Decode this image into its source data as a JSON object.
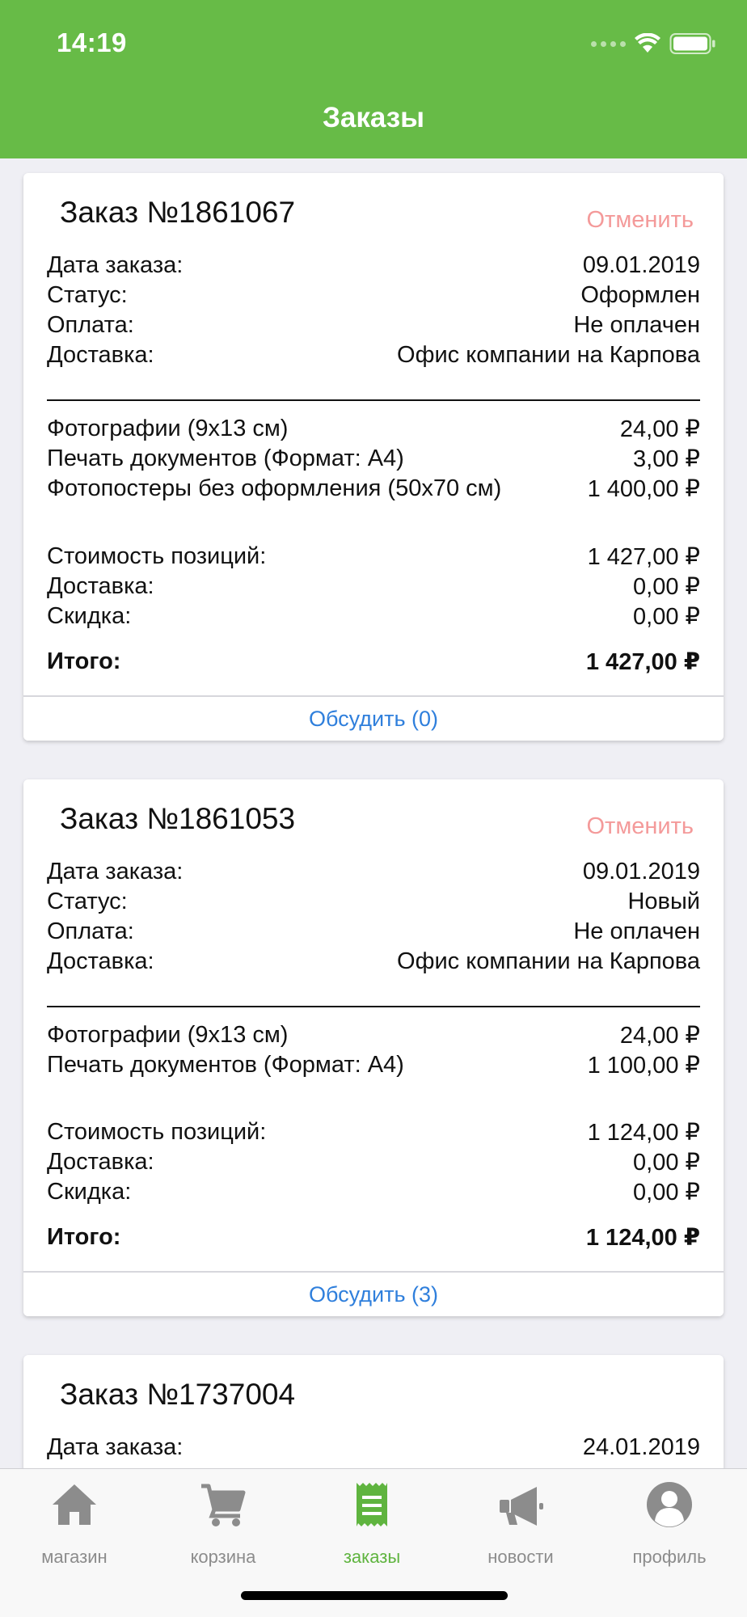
{
  "status_bar": {
    "time": "14:19"
  },
  "header": {
    "title": "Заказы"
  },
  "orders": [
    {
      "title": "Заказ №1861067",
      "cancel_label": "Отменить",
      "info": [
        {
          "label": "Дата заказа:",
          "value": "09.01.2019"
        },
        {
          "label": "Статус:",
          "value": "Оформлен"
        },
        {
          "label": "Оплата:",
          "value": "Не оплачен"
        },
        {
          "label": "Доставка:",
          "value": "Офис компании на Карпова"
        }
      ],
      "items": [
        {
          "label": "Фотографии (9x13 см)",
          "value": "24,00 ₽"
        },
        {
          "label": "Печать документов (Формат: A4)",
          "value": "3,00 ₽"
        },
        {
          "label": "Фотопостеры без оформления (50x70 см)",
          "value": "1 400,00 ₽"
        }
      ],
      "totals": [
        {
          "label": "Стоимость позиций:",
          "value": "1 427,00 ₽"
        },
        {
          "label": "Доставка:",
          "value": "0,00 ₽"
        },
        {
          "label": "Скидка:",
          "value": "0,00 ₽"
        }
      ],
      "grand_total": {
        "label": "Итого:",
        "value": "1 427,00 ₽"
      },
      "discuss_label": "Обсудить (0)"
    },
    {
      "title": "Заказ №1861053",
      "cancel_label": "Отменить",
      "info": [
        {
          "label": "Дата заказа:",
          "value": "09.01.2019"
        },
        {
          "label": "Статус:",
          "value": "Новый"
        },
        {
          "label": "Оплата:",
          "value": "Не оплачен"
        },
        {
          "label": "Доставка:",
          "value": "Офис компании на Карпова"
        }
      ],
      "items": [
        {
          "label": "Фотографии (9x13 см)",
          "value": "24,00 ₽"
        },
        {
          "label": "Печать документов (Формат: A4)",
          "value": "1 100,00 ₽"
        }
      ],
      "totals": [
        {
          "label": "Стоимость позиций:",
          "value": "1 124,00 ₽"
        },
        {
          "label": "Доставка:",
          "value": "0,00 ₽"
        },
        {
          "label": "Скидка:",
          "value": "0,00 ₽"
        }
      ],
      "grand_total": {
        "label": "Итого:",
        "value": "1 124,00 ₽"
      },
      "discuss_label": "Обсудить (3)"
    },
    {
      "title": "Заказ №1737004",
      "info": [
        {
          "label": "Дата заказа:",
          "value": "24.01.2019"
        }
      ]
    }
  ],
  "tabbar": {
    "tabs": [
      {
        "label": "магазин",
        "icon": "home-icon",
        "active": false
      },
      {
        "label": "корзина",
        "icon": "cart-icon",
        "active": false
      },
      {
        "label": "заказы",
        "icon": "receipt-icon",
        "active": true
      },
      {
        "label": "новости",
        "icon": "megaphone-icon",
        "active": false
      },
      {
        "label": "профиль",
        "icon": "profile-icon",
        "active": false
      }
    ]
  },
  "colors": {
    "brand_green": "#67bb47",
    "active_tab": "#5fb43f",
    "inactive_tab": "#8c8c8c",
    "cancel": "#f49a9a",
    "link": "#2f7fdc"
  }
}
